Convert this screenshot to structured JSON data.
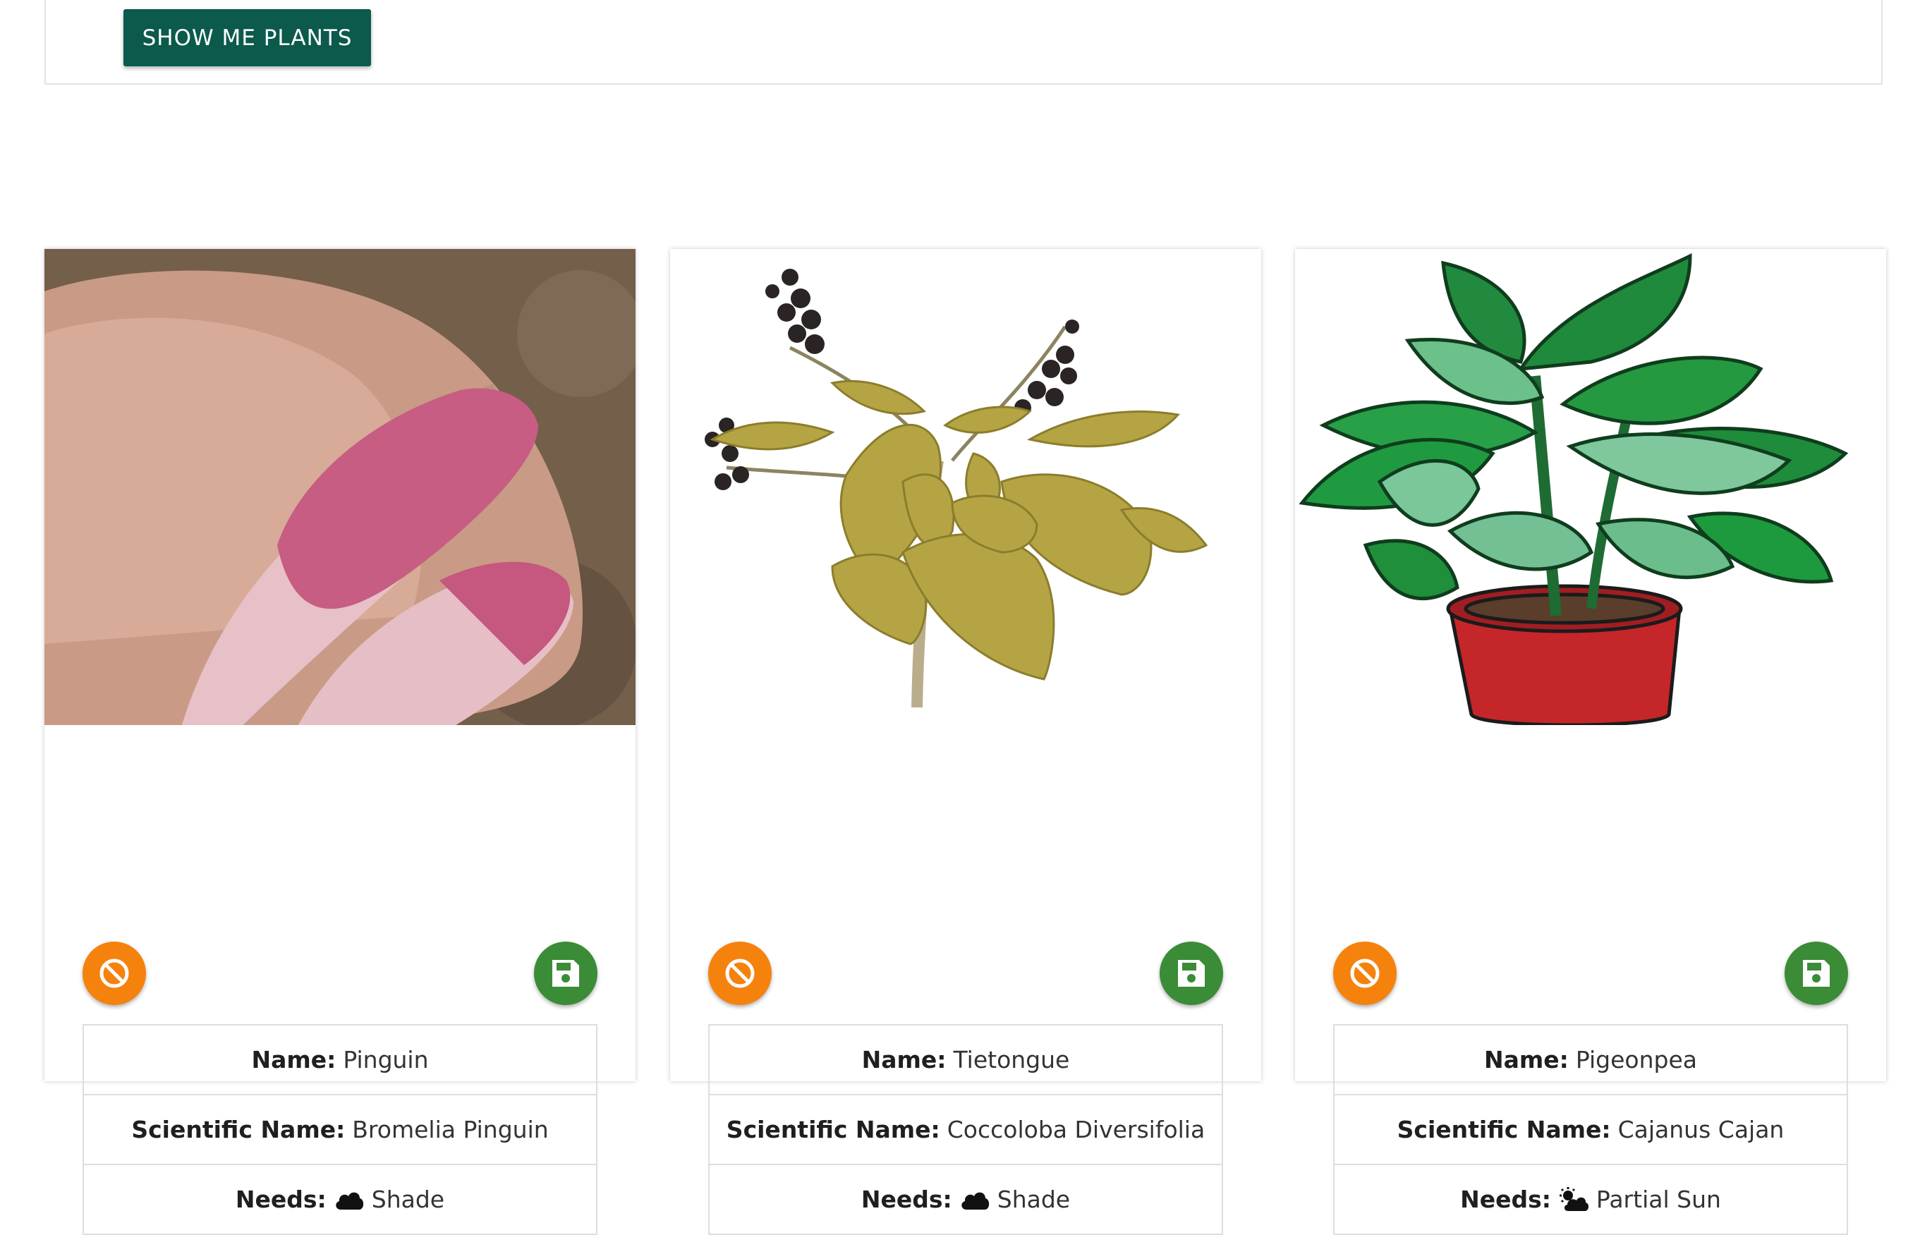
{
  "top_bar": {
    "show_button_label": "SHOW ME PLANTS"
  },
  "labels": {
    "name": "Name:",
    "scientific_name": "Scientific Name:",
    "needs": "Needs:"
  },
  "colors": {
    "primary_button": "#0b5a4c",
    "discard_button": "#f5820d",
    "save_button": "#3a8c36"
  },
  "icons": {
    "discard": "ban-icon",
    "save": "floppy-disk-icon",
    "shade": "cloud-icon",
    "partial_sun": "cloud-sun-icon"
  },
  "plants": [
    {
      "name": "Pinguin",
      "scientific_name": "Bromelia Pinguin",
      "needs": "Shade",
      "needs_icon": "cloud-icon",
      "image": "plant-photo-pinguin"
    },
    {
      "name": "Tietongue",
      "scientific_name": "Coccoloba Diversifolia",
      "needs": "Shade",
      "needs_icon": "cloud-icon",
      "image": "plant-illustration-tietongue"
    },
    {
      "name": "Pigeonpea",
      "scientific_name": "Cajanus Cajan",
      "needs": "Partial Sun",
      "needs_icon": "cloud-sun-icon",
      "image": "plant-clipart-pigeonpea"
    }
  ]
}
